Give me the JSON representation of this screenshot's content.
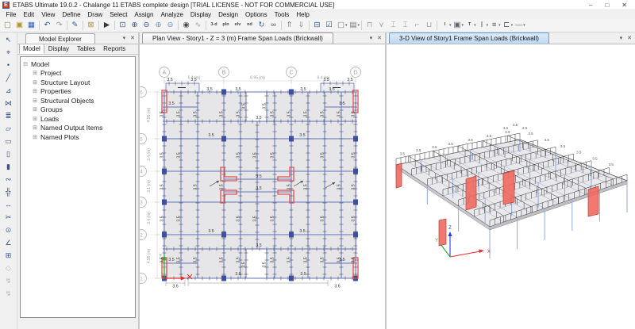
{
  "window": {
    "title": "ETABS Ultimate 19.0.2 - Chalange 11 ETABS complete design  [TRIAL LICENSE - NOT FOR COMMERCIAL USE]",
    "app_icon_letter": "E",
    "controls": {
      "minimize": "–",
      "maximize": "□",
      "close": "✕"
    }
  },
  "menu_items": [
    "File",
    "Edit",
    "View",
    "Define",
    "Draw",
    "Select",
    "Assign",
    "Analyze",
    "Display",
    "Design",
    "Options",
    "Tools",
    "Help"
  ],
  "toolbar_icons": [
    {
      "name": "new-model",
      "glyph": "▢",
      "color": "#8a7a52"
    },
    {
      "name": "open-file",
      "glyph": "▣",
      "color": "#b8912f"
    },
    {
      "name": "save",
      "glyph": "▦",
      "color": "#2b5fb4"
    },
    {
      "sep": true
    },
    {
      "name": "undo",
      "glyph": "↶",
      "color": "#33538e"
    },
    {
      "name": "redo",
      "glyph": "↷",
      "color": "#9a9a9a"
    },
    {
      "sep": true
    },
    {
      "name": "edit-pen",
      "glyph": "✎",
      "color": "#33538e"
    },
    {
      "sep": true
    },
    {
      "name": "lock-model",
      "glyph": "⊠",
      "color": "#b8912f"
    },
    {
      "sep": true
    },
    {
      "name": "run-analysis",
      "glyph": "▶",
      "color": "#3a3a3a"
    },
    {
      "sep": true
    },
    {
      "name": "rubber-band-zoom",
      "glyph": "⊡",
      "color": "#33538e"
    },
    {
      "name": "restore-full-view",
      "glyph": "⊕",
      "color": "#33538e"
    },
    {
      "name": "previous-zoom",
      "glyph": "⊖",
      "color": "#33538e"
    },
    {
      "name": "zoom-in-one-step",
      "glyph": "⊕",
      "color": "#6f94c4"
    },
    {
      "name": "zoom-out-one-step",
      "glyph": "⊖",
      "color": "#6f94c4"
    },
    {
      "sep": true
    },
    {
      "name": "rotate-view",
      "glyph": "◉",
      "color": "#4a4a4a"
    },
    {
      "name": "snap-options",
      "glyph": "∿",
      "color": "#9a9a9a"
    },
    {
      "sep": true
    },
    {
      "name": "view-3d",
      "glyph": "3-d",
      "text": true
    },
    {
      "name": "view-plan",
      "glyph": "pln",
      "text": true
    },
    {
      "name": "view-elevation",
      "glyph": "elv",
      "text": true
    },
    {
      "name": "view-named",
      "glyph": "nd",
      "text": true
    },
    {
      "name": "rotate-3d-view",
      "glyph": "↻",
      "color": "#2b5fb4"
    },
    {
      "name": "perspective-toggle",
      "glyph": "∞",
      "color": "#555555"
    },
    {
      "sep": true
    },
    {
      "name": "move-up-in-list",
      "glyph": "⇑",
      "color": "#3f9b3f"
    },
    {
      "name": "move-down-in-list",
      "glyph": "⇓",
      "color": "#8a8a8a"
    },
    {
      "sep": true
    },
    {
      "name": "object-shrink-toggle",
      "glyph": "⊟",
      "color": "#33538e"
    },
    {
      "name": "set-display-options",
      "glyph": "☑",
      "color": "#33538e"
    },
    {
      "name": "window-layout",
      "glyph": "▢",
      "color": "#777777",
      "dropdown": true
    },
    {
      "name": "more-views",
      "glyph": "▤",
      "color": "#777777",
      "dropdown": true
    },
    {
      "sep": true
    },
    {
      "name": "draw-frame-tool",
      "glyph": "⊓",
      "color": "#9a9a9a"
    },
    {
      "name": "draw-brace-tool",
      "glyph": "⋎",
      "color": "#9a9a9a"
    },
    {
      "name": "extrude-tool",
      "glyph": "⌶",
      "color": "#9a9a9a"
    },
    {
      "name": "section-cut-tool",
      "glyph": "⌶",
      "color": "#9a9a9a"
    },
    {
      "name": "hook-tool",
      "glyph": "⌐",
      "color": "#9a9a9a"
    },
    {
      "name": "merge-tool",
      "glyph": "⊔",
      "color": "#9a9a9a"
    },
    {
      "sep": true
    },
    {
      "name": "frame-i-section",
      "glyph": "I",
      "text": true,
      "dropdown": true
    },
    {
      "name": "frame-rect-section",
      "glyph": "▣",
      "color": "#5a6377",
      "dropdown": true
    },
    {
      "name": "frame-t-section",
      "glyph": "T",
      "text": true,
      "dropdown": true
    },
    {
      "name": "frame-wide-flange",
      "glyph": "Ⅰ",
      "color": "#5a6377",
      "dropdown": true
    },
    {
      "name": "slab-section",
      "glyph": "≡",
      "color": "#5a6377",
      "dropdown": true
    },
    {
      "name": "channel-section",
      "glyph": "⊏",
      "color": "#5a6377",
      "dropdown": true
    },
    {
      "name": "line-section",
      "glyph": "—",
      "color": "#5a6377",
      "dropdown": true
    }
  ],
  "side_toolbar_icons": [
    {
      "name": "select-pointer",
      "glyph": "↖"
    },
    {
      "name": "reshape-object",
      "glyph": "⌖"
    },
    {
      "name": "draw-joint",
      "glyph": "•"
    },
    {
      "name": "draw-frame",
      "glyph": "╱"
    },
    {
      "name": "quick-draw-frame",
      "glyph": "⊿"
    },
    {
      "name": "quick-draw-braces",
      "glyph": "⋈"
    },
    {
      "name": "quick-draw-secondary-beams",
      "glyph": "≣"
    },
    {
      "name": "draw-floor",
      "glyph": "▱"
    },
    {
      "name": "quick-draw-floor",
      "glyph": "▭"
    },
    {
      "name": "draw-wall",
      "glyph": "▯"
    },
    {
      "name": "quick-draw-wall",
      "glyph": "▮"
    },
    {
      "name": "draw-link",
      "glyph": "∾"
    },
    {
      "name": "draw-grid",
      "glyph": "╬"
    },
    {
      "name": "draw-dimension-line",
      "glyph": "↔"
    },
    {
      "name": "draw-section-cut",
      "glyph": "✂"
    },
    {
      "name": "draw-reference-point",
      "glyph": "⊙"
    },
    {
      "name": "measure-tool",
      "glyph": "∠"
    },
    {
      "name": "snap-to-grid",
      "glyph": "⊞"
    },
    {
      "name": "snap-to-ends",
      "glyph": "◇",
      "muted": true
    },
    {
      "name": "snap-to-midpoints",
      "glyph": "↯",
      "muted": true
    },
    {
      "name": "snap-to-intersections",
      "glyph": "↯",
      "muted": true
    }
  ],
  "icons": {
    "pane_dropdown": "▾",
    "pane_close": "✕",
    "tree_collapse": "⊟",
    "tree_expand": "⊞"
  },
  "model_explorer": {
    "panel_title": "Model Explorer",
    "tabs": [
      "Model",
      "Display",
      "Tables",
      "Reports"
    ],
    "active_tab": "Model",
    "tree": {
      "root": "Model",
      "children": [
        "Project",
        "Structure Layout",
        "Properties",
        "Structural Objects",
        "Groups",
        "Loads",
        "Named Output Items",
        "Named Plots"
      ]
    }
  },
  "plan_view": {
    "title": "Plan View - Story1 - Z = 3 (m)  Frame Span Loads (Brickwall)",
    "grid_columns": [
      "A",
      "B",
      "C",
      "D"
    ],
    "grid_rows": [
      "6",
      "5",
      "4",
      "3",
      "2",
      "1"
    ],
    "x_dims": [
      "6.4 (m)",
      "6.95 (m)",
      "6.4 (m)"
    ],
    "y_dims": [
      "4.95 (m)",
      "3.4 (m)",
      "3.1 (m)",
      "3.4 (m)",
      "4.95 (m)"
    ],
    "frame_load_value": "3.5",
    "corner_load_value": "3.6",
    "axes": {
      "x": "X",
      "y": "Y"
    }
  },
  "view_3d": {
    "title": "3-D View of Story1  Frame Span Loads (Brickwall)",
    "frame_load_value": "3.5",
    "axes": {
      "x": "X",
      "y": "Y",
      "z": "Z"
    }
  },
  "colors": {
    "beam": "#6273b8",
    "column": "#3d4fa0",
    "slab": "#e6e6e8",
    "wall_highlight": "#e0514d",
    "load_tick": "#4a4a4a",
    "dim_text": "#9a9a9a",
    "grid_circle": "#b8b8b8",
    "axis_x": "#e03030",
    "axis_y": "#2fae2f",
    "axis_z": "#2040e0",
    "column_3d": "#97a6de"
  }
}
